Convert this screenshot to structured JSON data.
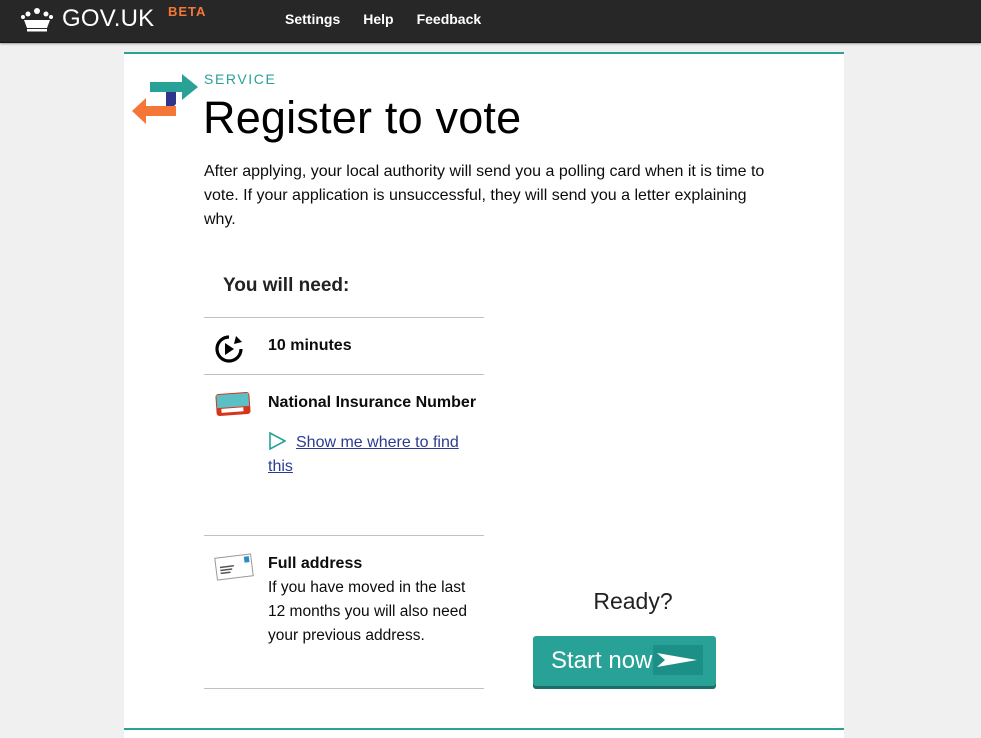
{
  "header": {
    "logo_text": "GOV.UK",
    "beta_label": "BETA",
    "nav": [
      "Settings",
      "Help",
      "Feedback"
    ]
  },
  "service": {
    "label": "SERVICE",
    "title": "Register to vote",
    "intro": "After applying, your local authority will send you a polling card when it is time to vote. If your application is unsuccessful, they will send you a letter explaining why."
  },
  "needs": {
    "heading": "You will need:",
    "items": [
      {
        "icon": "clock-icon",
        "title": "10 minutes"
      },
      {
        "icon": "ni-card-icon",
        "title": "National Insurance Number",
        "link": "Show me where to find this"
      },
      {
        "icon": "envelope-icon",
        "title": "Full address",
        "body": "If you have moved in the last 12 months you will also need your previous address."
      }
    ]
  },
  "cta": {
    "ready_text": "Ready?",
    "button_label": "Start now"
  },
  "colors": {
    "header_bg": "#272727",
    "accent": "#28a197",
    "beta": "#f47738",
    "link": "#2b3b8f"
  }
}
